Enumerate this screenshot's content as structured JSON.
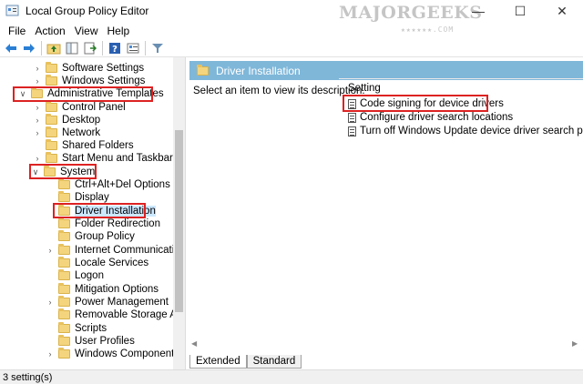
{
  "window": {
    "title": "Local Group Policy Editor",
    "controls": {
      "minimize": "—",
      "maximize": "☐",
      "close": "✕"
    }
  },
  "watermark": {
    "text": "MAJORGEEKS",
    "sub": "★★★★★★.COM"
  },
  "menu": {
    "items": [
      "File",
      "Action",
      "View",
      "Help"
    ]
  },
  "toolbar": {
    "icons": [
      "back-arrow-icon",
      "forward-arrow-icon",
      "up-folder-icon",
      "show-hide-tree-icon",
      "export-list-icon",
      "help-icon",
      "properties-icon",
      "filter-icon"
    ]
  },
  "tree": {
    "items": [
      {
        "label": "Software Settings",
        "chevron": ">",
        "expanded": false
      },
      {
        "label": "Windows Settings",
        "chevron": ">",
        "expanded": false
      },
      {
        "label": "Administrative Templates",
        "chevron": "v",
        "expanded": true,
        "highlighted": true
      },
      {
        "label": "Control Panel",
        "chevron": ">"
      },
      {
        "label": "Desktop",
        "chevron": ">"
      },
      {
        "label": "Network",
        "chevron": ">"
      },
      {
        "label": "Shared Folders",
        "chevron": ""
      },
      {
        "label": "Start Menu and Taskbar",
        "chevron": ">"
      },
      {
        "label": "System",
        "chevron": "v",
        "expanded": true,
        "highlighted": true
      },
      {
        "label": "Ctrl+Alt+Del Options",
        "chevron": ""
      },
      {
        "label": "Display",
        "chevron": ""
      },
      {
        "label": "Driver Installation",
        "chevron": "",
        "selected": true,
        "highlighted": true
      },
      {
        "label": "Folder Redirection",
        "chevron": ""
      },
      {
        "label": "Group Policy",
        "chevron": ""
      },
      {
        "label": "Internet Communication",
        "chevron": ">"
      },
      {
        "label": "Locale Services",
        "chevron": ""
      },
      {
        "label": "Logon",
        "chevron": ""
      },
      {
        "label": "Mitigation Options",
        "chevron": ""
      },
      {
        "label": "Power Management",
        "chevron": ">"
      },
      {
        "label": "Removable Storage Acces",
        "chevron": ""
      },
      {
        "label": "Scripts",
        "chevron": ""
      },
      {
        "label": "User Profiles",
        "chevron": ""
      },
      {
        "label": "Windows Components",
        "chevron": ">"
      }
    ]
  },
  "details": {
    "header": "Driver Installation",
    "description": "Select an item to view its description.",
    "column": "Setting",
    "settings": [
      {
        "label": "Code signing for device drivers",
        "highlighted": true
      },
      {
        "label": "Configure driver search locations"
      },
      {
        "label": "Turn off Windows Update device driver search prompt"
      }
    ]
  },
  "tabs": [
    "Extended",
    "Standard"
  ],
  "status": "3 setting(s)",
  "colors": {
    "header_bg": "#7fb7d9",
    "highlight_box": "#dd2222",
    "selection": "#cce8ff"
  }
}
